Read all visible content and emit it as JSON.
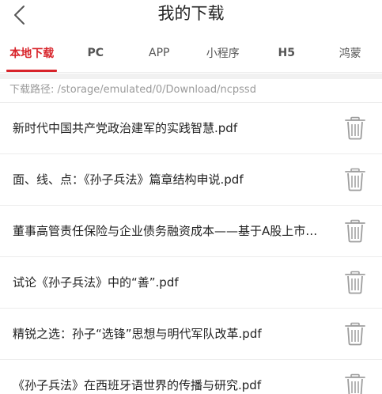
{
  "header": {
    "title": "我的下载",
    "back_icon": "chevron-left-icon"
  },
  "tabs": [
    {
      "label": "本地下载",
      "active": true
    },
    {
      "label": "PC",
      "active": false
    },
    {
      "label": "APP",
      "active": false
    },
    {
      "label": "小程序",
      "active": false
    },
    {
      "label": "H5",
      "active": false
    },
    {
      "label": "鸿蒙",
      "active": false
    }
  ],
  "download_path": "下载路径: /storage/emulated/0/Download/ncpssd",
  "files": [
    {
      "name": "新时代中国共产党政治建军的实践智慧.pdf"
    },
    {
      "name": "面、线、点：《孙子兵法》篇章结构申说.pdf"
    },
    {
      "name": "董事高管责任保险与企业债务融资成本——基于A股上市公司的证据.pdf"
    },
    {
      "name": "试论《孙子兵法》中的“善”.pdf"
    },
    {
      "name": "精锐之选：孙子“选锋”思想与明代军队改革.pdf"
    },
    {
      "name": "《孙子兵法》在西班牙语世界的传播与研究.pdf"
    }
  ],
  "colors": {
    "accent": "#d8232a",
    "text": "#222222",
    "muted": "#9a9a9a",
    "icon": "#9e9e9e"
  },
  "icons": {
    "delete": "trash-icon"
  }
}
